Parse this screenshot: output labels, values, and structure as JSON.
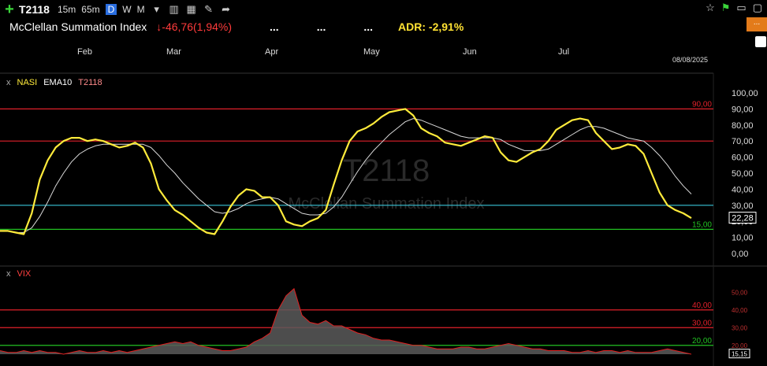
{
  "toolbar": {
    "symbol": "T2118",
    "timeframes": [
      "15m",
      "65m",
      "D",
      "W",
      "M"
    ],
    "active_timeframe": "D",
    "icons": [
      "dropdown-icon",
      "bar-chart-icon",
      "grid-icon",
      "pencil-icon",
      "share-icon",
      "star-icon",
      "flag-icon",
      "rt-icon",
      "minimize-icon",
      "window-icon"
    ]
  },
  "info": {
    "name": "McClellan Summation Index",
    "change": "-46,76",
    "change_pct": "(1,94%)",
    "dots": [
      "...",
      "...",
      "..."
    ],
    "adr": "ADR: -2,91%"
  },
  "colors": {
    "yellow": "#ffeb3b",
    "ema": "#d9d9d9",
    "red_line": "#e0202a",
    "cyan_line": "#38c4d8",
    "green_line": "#22c022",
    "vix_line": "#e02020",
    "vix_fill": "#5a5a5a",
    "orange_btn": "#e37b1a"
  },
  "chart_data": [
    {
      "type": "line",
      "title": "T2118",
      "subtitle": "McClellan Summation Index",
      "date_tag": "08/08/2025",
      "x_labels": [
        "Feb",
        "Mar",
        "Apr",
        "May",
        "Jun",
        "Jul"
      ],
      "legend": [
        "NASI",
        "EMA10",
        "T2118"
      ],
      "ylim": [
        0,
        100
      ],
      "y_ticks": [
        "100,00",
        "90,00",
        "80,00",
        "70,00",
        "60,00",
        "50,00",
        "40,00",
        "30,00",
        "20,00",
        "10,00",
        "0,00"
      ],
      "current_value": "22,28",
      "hlines": [
        {
          "value": 90,
          "label": "90,00",
          "color": "#e0202a"
        },
        {
          "value": 70,
          "label": "",
          "color": "#e0202a"
        },
        {
          "value": 30,
          "label": "",
          "color": "#38c4d8"
        },
        {
          "value": 15,
          "label": "15,00",
          "color": "#22c022"
        }
      ],
      "series": [
        {
          "name": "T2118",
          "values": [
            14,
            14,
            13,
            12,
            25,
            46,
            58,
            66,
            70,
            72,
            72,
            70,
            71,
            70,
            68,
            66,
            67,
            69,
            66,
            56,
            40,
            33,
            27,
            24,
            20,
            16,
            13,
            12,
            20,
            29,
            36,
            40,
            39,
            35,
            35,
            30,
            20,
            18,
            17,
            20,
            22,
            27,
            43,
            58,
            70,
            76,
            78,
            81,
            85,
            88,
            89,
            90,
            86,
            78,
            75,
            73,
            69,
            68,
            67,
            69,
            71,
            73,
            72,
            63,
            58,
            57,
            60,
            63,
            65,
            70,
            77,
            80,
            83,
            84,
            83,
            75,
            70,
            65,
            66,
            68,
            67,
            62,
            50,
            38,
            30,
            27,
            25,
            22
          ]
        },
        {
          "name": "EMA10",
          "values": [
            14,
            14,
            13,
            13,
            16,
            23,
            32,
            42,
            50,
            57,
            62,
            65,
            67,
            68,
            68,
            68,
            68,
            68,
            68,
            66,
            61,
            55,
            50,
            44,
            39,
            34,
            30,
            26,
            25,
            26,
            28,
            31,
            33,
            34,
            35,
            34,
            31,
            28,
            25,
            24,
            24,
            25,
            29,
            35,
            43,
            51,
            58,
            64,
            69,
            74,
            78,
            82,
            84,
            83,
            81,
            79,
            77,
            75,
            73,
            72,
            72,
            72,
            72,
            71,
            68,
            66,
            64,
            64,
            64,
            65,
            68,
            71,
            74,
            77,
            79,
            79,
            78,
            76,
            74,
            72,
            71,
            70,
            66,
            61,
            55,
            48,
            42,
            37
          ]
        }
      ]
    },
    {
      "type": "area",
      "title": "VIX",
      "legend": [
        "VIX"
      ],
      "ylim": [
        15,
        55
      ],
      "y_ticks": [
        "50,00",
        "40,00",
        "30,00",
        "20,00"
      ],
      "current_value": "15,15",
      "hlines": [
        {
          "value": 40,
          "label": "40,00",
          "color": "#e0202a"
        },
        {
          "value": 30,
          "label": "30,00",
          "color": "#e0202a"
        },
        {
          "value": 20,
          "label": "20,00",
          "color": "#22c022"
        }
      ],
      "values": [
        17,
        16,
        16,
        17,
        16,
        17,
        16,
        16,
        15,
        16,
        17,
        16,
        16,
        17,
        16,
        17,
        16,
        17,
        18,
        19,
        20,
        21,
        22,
        21,
        22,
        20,
        19,
        18,
        17,
        17,
        18,
        19,
        22,
        24,
        27,
        40,
        48,
        52,
        37,
        33,
        32,
        34,
        31,
        31,
        29,
        27,
        26,
        24,
        23,
        23,
        22,
        21,
        20,
        20,
        19,
        18,
        18,
        18,
        19,
        19,
        18,
        18,
        19,
        20,
        21,
        20,
        19,
        18,
        18,
        17,
        17,
        17,
        16,
        16,
        17,
        16,
        17,
        17,
        16,
        17,
        16,
        16,
        16,
        17,
        18,
        17,
        16,
        15
      ]
    }
  ]
}
